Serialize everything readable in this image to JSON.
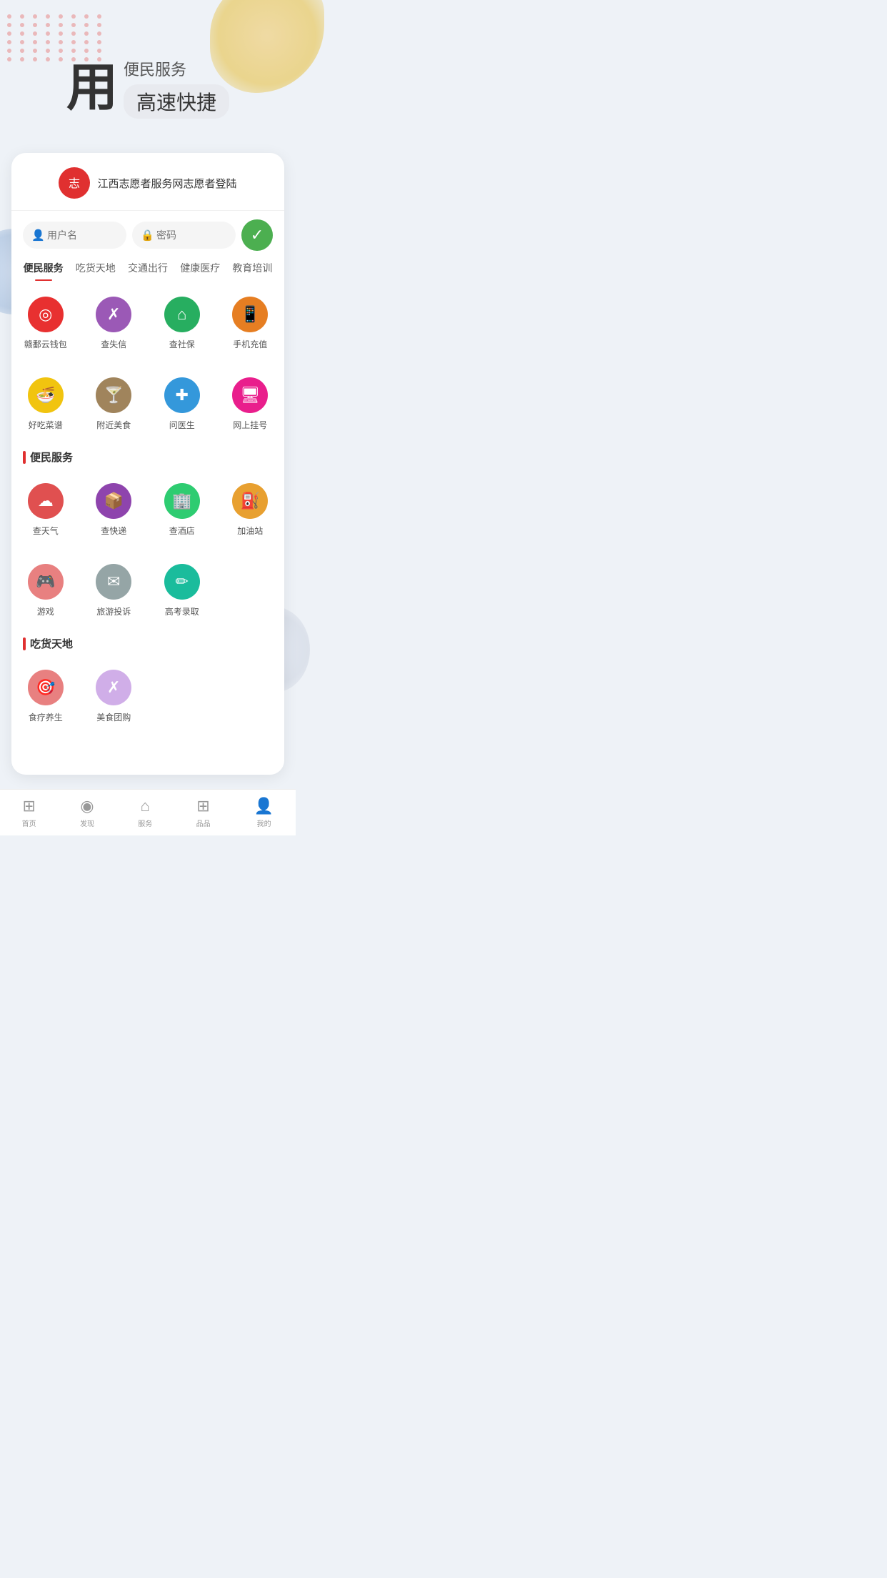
{
  "hero": {
    "main_char": "用",
    "subtitle1": "便民服务",
    "subtitle2": "高速快捷"
  },
  "login": {
    "title": "江西志愿者服务网志愿者登陆",
    "username_placeholder": "用户名",
    "password_placeholder": "密码"
  },
  "tabs": [
    {
      "label": "便民服务",
      "active": true
    },
    {
      "label": "吃货天地",
      "active": false
    },
    {
      "label": "交通出行",
      "active": false
    },
    {
      "label": "健康医疗",
      "active": false
    },
    {
      "label": "教育培训",
      "active": false
    }
  ],
  "service_rows": [
    {
      "items": [
        {
          "label": "赣鄱云钱包",
          "color": "ic-red",
          "icon": "◎"
        },
        {
          "label": "查失信",
          "color": "ic-purple",
          "icon": "✗"
        },
        {
          "label": "查社保",
          "color": "ic-green",
          "icon": "⌂"
        },
        {
          "label": "手机充值",
          "color": "ic-orange",
          "icon": "📱"
        }
      ]
    },
    {
      "items": [
        {
          "label": "好吃菜谱",
          "color": "ic-yellow",
          "icon": "🍜"
        },
        {
          "label": "附近美食",
          "color": "ic-brown",
          "icon": "🍸"
        },
        {
          "label": "问医生",
          "color": "ic-blue",
          "icon": "✚"
        },
        {
          "label": "网上挂号",
          "color": "ic-pink",
          "icon": "🖥"
        }
      ]
    }
  ],
  "section1_title": "便民服务",
  "service_rows2": [
    {
      "items": [
        {
          "label": "查天气",
          "color": "ic-red2",
          "icon": "☁"
        },
        {
          "label": "查快递",
          "color": "ic-purple2",
          "icon": "📦"
        },
        {
          "label": "查酒店",
          "color": "ic-green2",
          "icon": "🏢"
        },
        {
          "label": "加油站",
          "color": "ic-orange2",
          "icon": "⛽"
        }
      ]
    },
    {
      "items": [
        {
          "label": "游戏",
          "color": "ic-salmon",
          "icon": "🎮"
        },
        {
          "label": "旅游投诉",
          "color": "ic-gray",
          "icon": "✉"
        },
        {
          "label": "高考录取",
          "color": "ic-teal",
          "icon": "✏"
        }
      ]
    }
  ],
  "section2_title": "吃货天地",
  "service_rows3": [
    {
      "items": [
        {
          "label": "食疗养生",
          "color": "ic-salmon",
          "icon": "🎯"
        },
        {
          "label": "美食团购",
          "color": "ic-lavender",
          "icon": "✗"
        }
      ]
    }
  ],
  "bottom_nav": [
    {
      "label": "首页",
      "icon": "⊞"
    },
    {
      "label": "发现",
      "icon": "◉"
    },
    {
      "label": "服务",
      "icon": "⌂"
    },
    {
      "label": "品品",
      "icon": "⊞"
    },
    {
      "label": "我的",
      "icon": "👤"
    }
  ]
}
